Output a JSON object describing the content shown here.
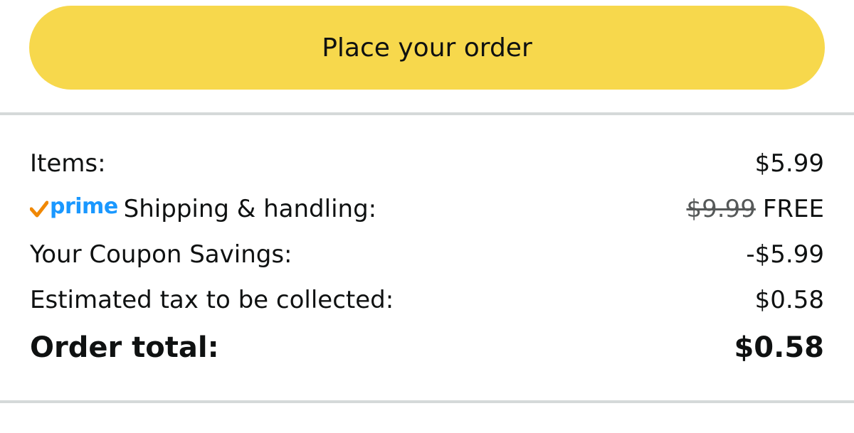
{
  "actions": {
    "place_order_label": "Place your order"
  },
  "badge": {
    "prime_word": "prime",
    "check_icon": "check-icon",
    "check_color": "#f08804",
    "prime_color": "#1a98ff"
  },
  "summary": {
    "items_label": "Items:",
    "items_value": "$5.99",
    "shipping_label": "Shipping & handling:",
    "shipping_original": "$9.99",
    "shipping_value": "FREE",
    "coupon_label": "Your Coupon Savings:",
    "coupon_value": "-$5.99",
    "tax_label": "Estimated tax to be collected:",
    "tax_value": "$0.58",
    "total_label": "Order total:",
    "total_value": "$0.58"
  },
  "colors": {
    "button_bg": "#f7d84c",
    "divider": "#d5d9d9",
    "text": "#0f1111"
  }
}
